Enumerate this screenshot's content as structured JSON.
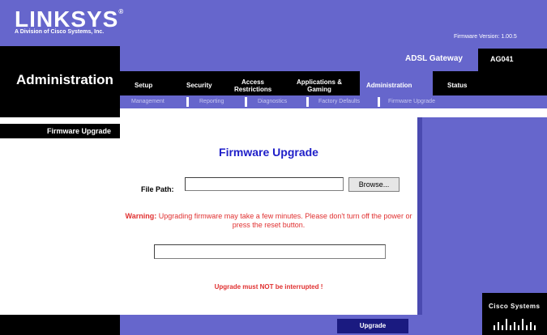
{
  "header": {
    "brand": "LINKSYS",
    "brand_mark": "®",
    "tagline": "A Division of Cisco Systems, Inc.",
    "firmware_version": "Firmware Version: 1.00.5"
  },
  "gateway": {
    "product_name": "ADSL Gateway",
    "model": "AG041"
  },
  "section_title": "Administration",
  "tabs": [
    {
      "label": "Setup"
    },
    {
      "label": "Security"
    },
    {
      "label": "Access Restrictions"
    },
    {
      "label": "Applications & Gaming"
    },
    {
      "label": "Administration",
      "active": true
    },
    {
      "label": "Status"
    }
  ],
  "subtabs": [
    {
      "label": "Management"
    },
    {
      "label": "Reporting"
    },
    {
      "label": "Diagnostics"
    },
    {
      "label": "Factory Defaults"
    },
    {
      "label": "Firmware Upgrade",
      "active": true
    }
  ],
  "sidebar": {
    "label": "Firmware Upgrade"
  },
  "content": {
    "title": "Firmware Upgrade",
    "file_path_label": "File Path:",
    "file_path_value": "",
    "browse_label": "Browse...",
    "warning_label": "Warning:",
    "warning_text": "Upgrading firmware may take a few minutes. Please don't turn off the power or press the reset button.",
    "interrupt_text": "Upgrade must NOT be interrupted !",
    "upgrade_button": "Upgrade"
  },
  "footer": {
    "cisco_logo": "Cisco Systems"
  },
  "colors": {
    "brand_blue": "#6666cc",
    "title_blue": "#1e1ec8",
    "warning_red": "#e03030",
    "black": "#000000"
  }
}
